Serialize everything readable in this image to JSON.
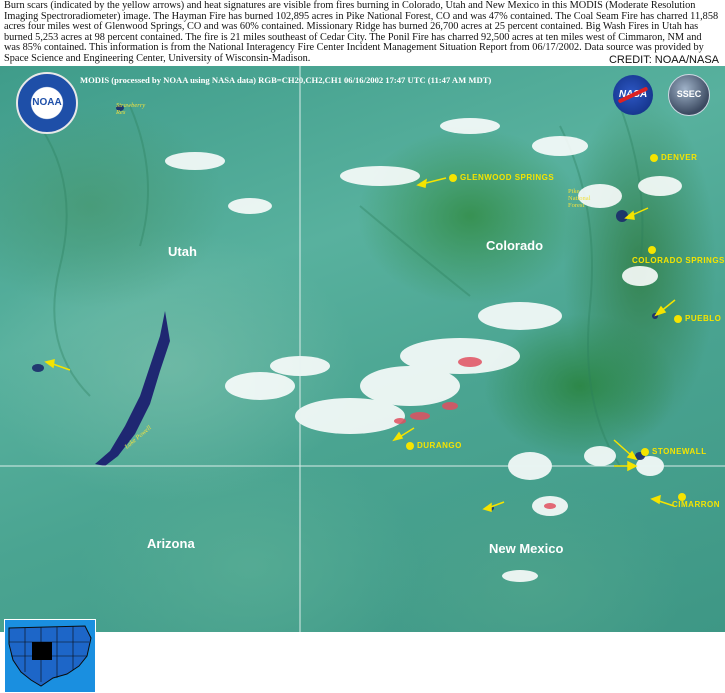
{
  "caption": "Burn scars (indicated by the yellow arrows) and heat signatures are visible from fires burning in Colorado, Utah and New Mexico in this MODIS (Moderate Resolution Imaging Spectroradiometer) image. The Hayman Fire has burned 102,895 acres in Pike National Forest, CO and was 47% contained. The Coal Seam Fire has charred 11,858 acres four miles west of Glenwood Springs, CO and was 60% contained. Missionary Ridge has burned 26,700 acres at 25 percent contained. Big Wash Fires in Utah has burned 5,253 acres at 98 percent contained. The fire is 21 miles southeast of Cedar City. The Ponil Fire has charred 92,500 acres at ten miles west of Cimmaron, NM and was 85% contained. This information is from the National Interagency Fire Center Incident Management Situation Report from 06/17/2002. Data source was provided by Space Science and Engineering Center, University of Wisconsin-Madison.",
  "credit": "CREDIT: NOAA/NASA",
  "map_header": "MODIS (processed by NOAA using NASA data) RGB=CH20,CH2,CH1 06/16/2002 17:47 UTC (11:47 AM MDT)",
  "logos": {
    "noaa": "NOAA",
    "nasa": "NASA",
    "ssec": "SSEC"
  },
  "states": {
    "utah": "Utah",
    "colorado": "Colorado",
    "arizona": "Arizona",
    "new_mexico": "New Mexico"
  },
  "cities": {
    "glenwood_springs": "Glenwood Springs",
    "denver": "Denver",
    "colorado_springs": "Colorado Springs",
    "pueblo": "Pueblo",
    "durango": "Durango",
    "stonewall": "Stonewall",
    "cimarron": "Cimarron"
  },
  "features": {
    "strawberry_res": "Strawberry Res",
    "lake_powell": "Lake Powell",
    "pike_national_forest": "Pike National Forest"
  },
  "colors": {
    "marker": "#f5e400",
    "fire": "#e05060",
    "cloud": "#ffffff"
  }
}
